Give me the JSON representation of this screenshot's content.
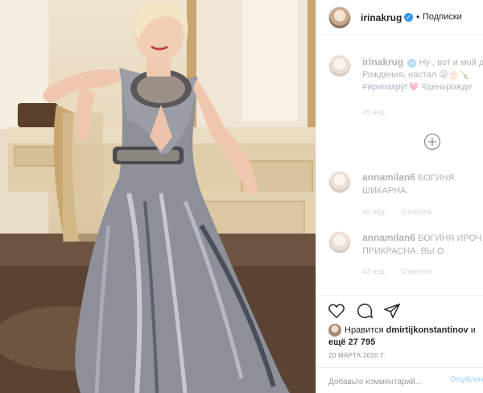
{
  "header": {
    "username": "irinakrug",
    "separator": "•",
    "follow_label": "Подписки"
  },
  "caption": {
    "username": "irinakrug",
    "text_line1": "Ну , вот и мой д",
    "text_line2": "Рождения, настал 😜🎂🍾",
    "hashtags_line": "#иринакруг💗 #деньрожде",
    "time": "45 нед."
  },
  "comments": [
    {
      "username": "annamilan6",
      "text": "БОГИНЯ. ШИКАРНА.",
      "time": "42 нед.",
      "reply_label": "Ответить"
    },
    {
      "username": "annamilan6",
      "text": "БОГИНЯ ИРОЧ ПРИКРАСНА. ВЫ О",
      "time": "42 нед.",
      "reply_label": "Ответить"
    }
  ],
  "likes": {
    "prefix": "Нравится",
    "liker": "dmirtijkonstantinov",
    "suffix": "и",
    "more": "ещё 27 795"
  },
  "date": "20 МАРТА 2020 Г.",
  "comment_box": {
    "placeholder": "Добавьте комментарий...",
    "publish_label": "Опубликовать"
  },
  "icons": {
    "like": "heart-icon",
    "comment": "comment-icon",
    "share": "share-icon",
    "load_more": "plus-circle-icon"
  }
}
